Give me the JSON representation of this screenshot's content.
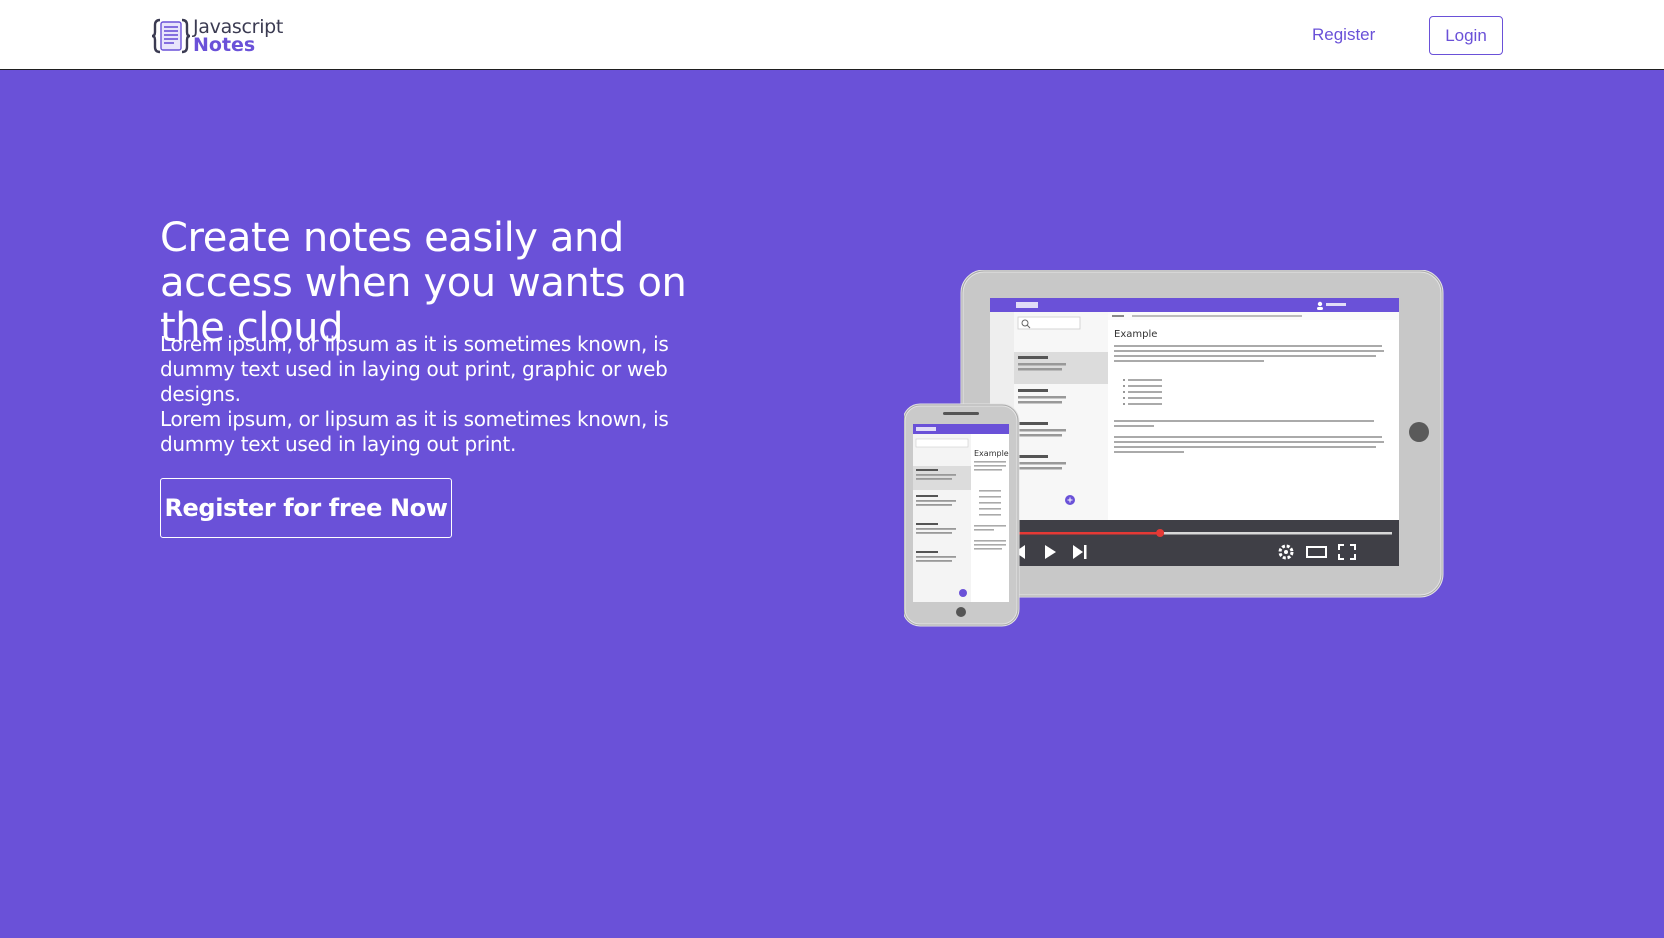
{
  "brand": {
    "line1": "Javascript",
    "line2": "Notes"
  },
  "nav": {
    "register_label": "Register",
    "login_label": "Login"
  },
  "hero": {
    "title": "Create notes easily and access when you wants on the cloud",
    "paragraph1": "Lorem ipsum, or lipsum as it is sometimes known, is dummy text used in laying out print, graphic or web designs.",
    "paragraph2": "Lorem ipsum, or lipsum as it is sometimes known, is dummy text used in laying out print.",
    "cta_label": "Register for free Now"
  },
  "illustration": {
    "tablet_note_title": "Example",
    "phone_note_title": "Example",
    "video_progress_fraction": 0.38,
    "icons": [
      "previous-icon",
      "play-icon",
      "next-icon",
      "settings-icon",
      "theater-mode-icon",
      "fullscreen-icon",
      "add-note-icon",
      "search-icon",
      "user-icon"
    ]
  },
  "colors": {
    "brand_purple": "#6a51d8",
    "text_white": "#ffffff",
    "video_bar": "#3f3f46",
    "progress_red": "#e53935"
  }
}
